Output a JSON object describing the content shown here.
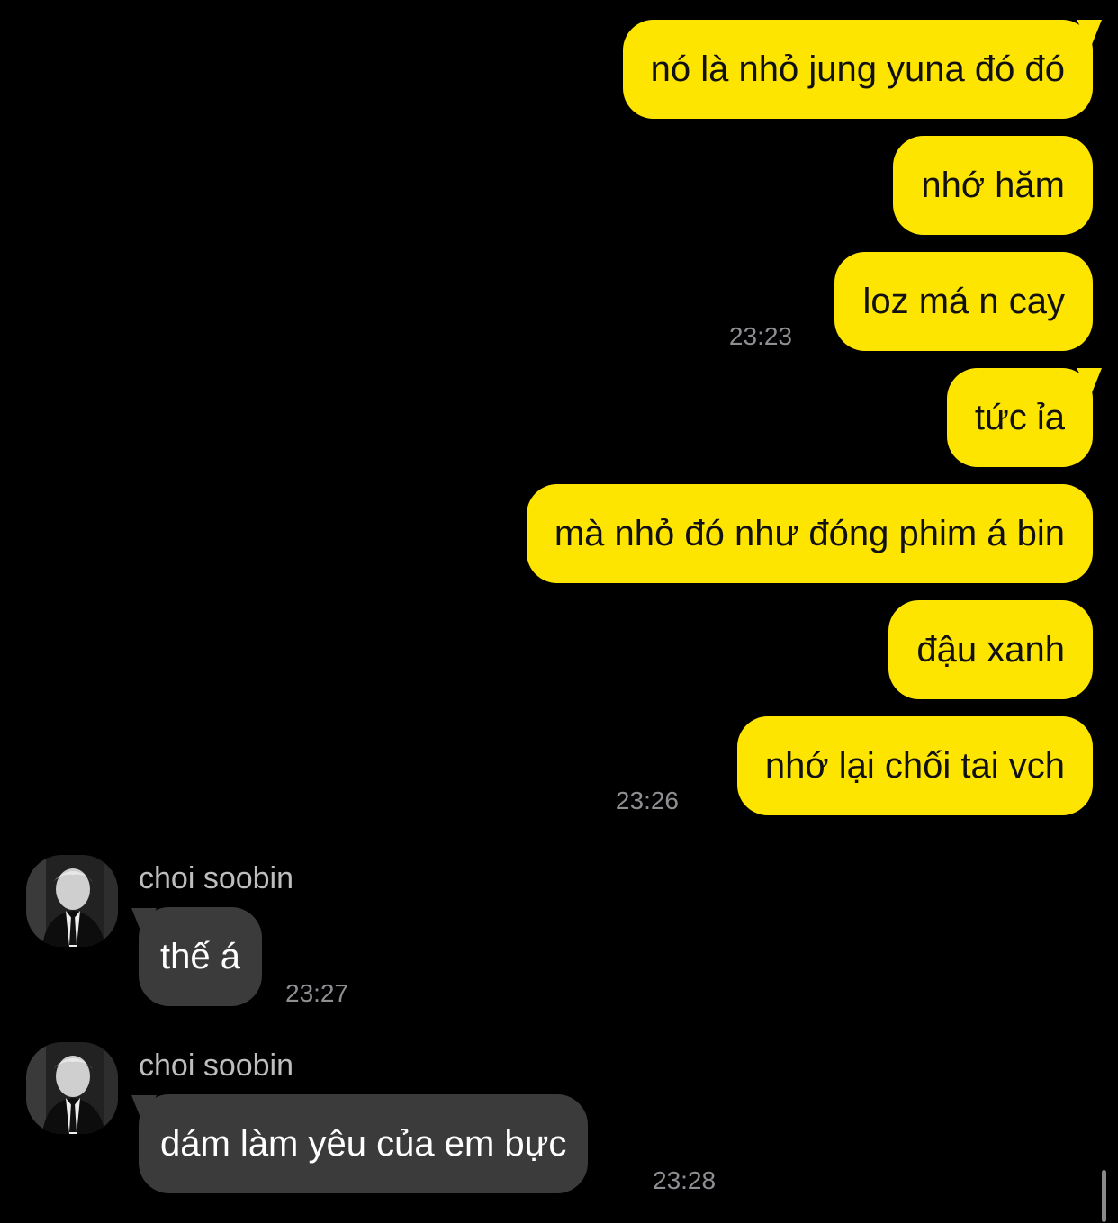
{
  "colors": {
    "background": "#000000",
    "outgoing_bubble": "#fee500",
    "incoming_bubble": "#3b3b3b",
    "timestamp": "#8e8e93"
  },
  "messages": [
    {
      "direction": "out",
      "text": "nó là nhỏ jung yuna đó đó"
    },
    {
      "direction": "out",
      "text": "nhớ hăm"
    },
    {
      "direction": "out",
      "text": "loz má n cay",
      "time": "23:23"
    },
    {
      "direction": "out",
      "text": "tức ỉa"
    },
    {
      "direction": "out",
      "text": "mà nhỏ đó như đóng phim á bin"
    },
    {
      "direction": "out",
      "text": "đậu xanh"
    },
    {
      "direction": "out",
      "text": "nhớ lại chối tai vch",
      "time": "23:26"
    },
    {
      "direction": "in",
      "sender": "choi soobin",
      "avatar": "profile-photo",
      "text": "thế á",
      "time": "23:27"
    },
    {
      "direction": "in",
      "sender": "choi soobin",
      "avatar": "profile-photo",
      "text": "dám làm yêu của em bực",
      "time": "23:28"
    }
  ]
}
